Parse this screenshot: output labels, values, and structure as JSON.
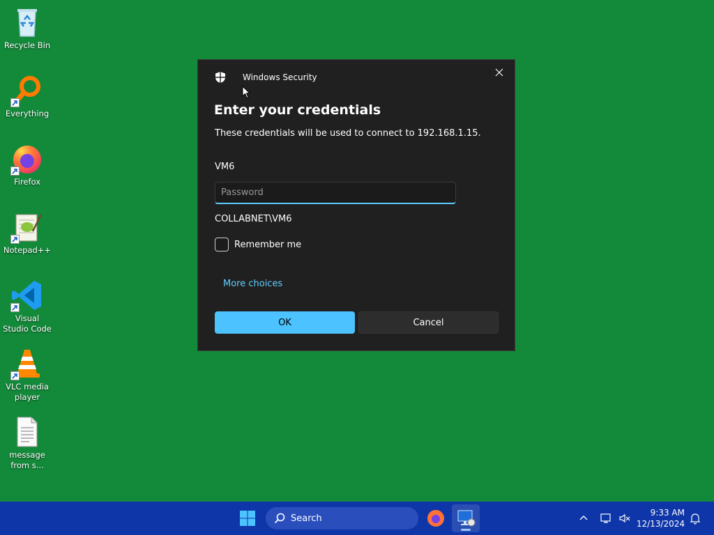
{
  "desktop": {
    "icons": [
      {
        "label": "Recycle Bin",
        "icon": "recycle-bin-icon"
      },
      {
        "label": "Everything",
        "icon": "everything-search-icon"
      },
      {
        "label": "Firefox",
        "icon": "firefox-icon"
      },
      {
        "label": "Notepad++",
        "icon": "notepad-plus-plus-icon"
      },
      {
        "label": "Visual Studio Code",
        "icon": "vscode-icon"
      },
      {
        "label": "VLC media player",
        "icon": "vlc-icon"
      },
      {
        "label": "message from s...",
        "icon": "text-file-icon"
      }
    ],
    "background_color": "#138a3a"
  },
  "dialog": {
    "app_title": "Windows Security",
    "heading": "Enter your credentials",
    "description": "These credentials will be used to connect to 192.168.1.15.",
    "username": "VM6",
    "password_placeholder": "Password",
    "password_value": "",
    "domain_user": "COLLABNET\\VM6",
    "remember_label": "Remember me",
    "remember_checked": false,
    "more_choices": "More choices",
    "ok_label": "OK",
    "cancel_label": "Cancel",
    "accent_color": "#4cc2ff"
  },
  "taskbar": {
    "search_label": "Search",
    "time": "9:33 AM",
    "date": "12/13/2024",
    "background_color": "#0e36a8"
  }
}
